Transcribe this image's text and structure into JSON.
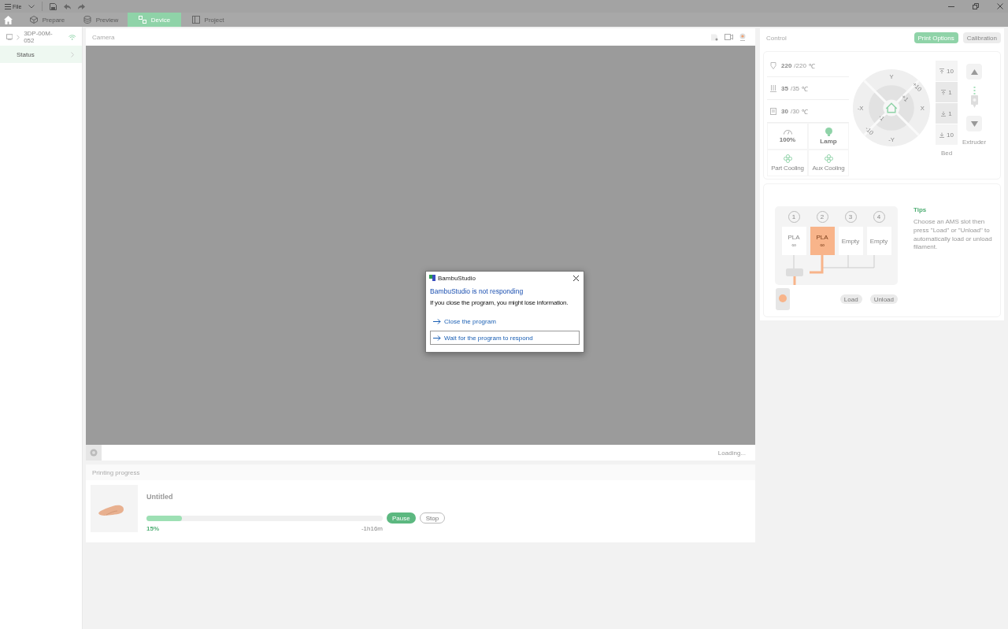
{
  "menu": {
    "file_label": "File"
  },
  "tabs": [
    {
      "label": "Prepare",
      "kind": "prepare",
      "selected": false
    },
    {
      "label": "Preview",
      "kind": "preview",
      "selected": false
    },
    {
      "label": "Device",
      "kind": "device",
      "selected": true
    },
    {
      "label": "Project",
      "kind": "project",
      "selected": false
    }
  ],
  "sidebar": {
    "device_name": "3DP-00M-052",
    "items": [
      {
        "label": "Status",
        "selected": true
      }
    ]
  },
  "camera": {
    "title": "Camera",
    "status": "Loading..."
  },
  "progress": {
    "title": "Printing progress",
    "job_name": "Untitled",
    "level": 0.15,
    "percent": "15%",
    "remaining": "-1h16m",
    "buttons": [
      "Pause",
      "Stop"
    ]
  },
  "control": {
    "title": "Control",
    "buttons": [
      {
        "label": "Print Options",
        "selected": true
      },
      {
        "label": "Calibration",
        "selected": false
      }
    ],
    "temps": [
      {
        "kind": "nozzle",
        "value": "220",
        "target": "/220",
        "unit": "℃"
      },
      {
        "kind": "bed",
        "value": "35",
        "target": "/35",
        "unit": "℃"
      },
      {
        "kind": "chamber",
        "value": "30",
        "target": "/30",
        "unit": "℃"
      }
    ],
    "speed": "100%",
    "lamp": "Lamp",
    "fans": [
      "Part Cooling",
      "Aux Cooling"
    ],
    "jog": {
      "y_plus": "Y",
      "y_minus": "-Y",
      "x_minus": "-X",
      "x_plus": "X",
      "plus_10": "+10",
      "plus_1": "+1",
      "minus_1": "-1",
      "minus_10": "-10"
    },
    "bed_steps": [
      {
        "kind": "up",
        "label": "10"
      },
      {
        "kind": "up",
        "label": "1"
      },
      {
        "kind": "down",
        "label": "1"
      },
      {
        "kind": "down",
        "label": "10"
      }
    ],
    "bed_label": "Bed",
    "extruder_label": "Extruder"
  },
  "ams": {
    "slots": [
      {
        "number": "1",
        "material": "PLA",
        "remain": "∞",
        "selected": false
      },
      {
        "number": "2",
        "material": "PLA",
        "remain": "∞",
        "selected": true
      },
      {
        "number": "3",
        "material": "Empty",
        "selected": false
      },
      {
        "number": "4",
        "material": "Empty",
        "selected": false
      }
    ],
    "tips_title": "Tips",
    "tips_text": "Choose an AMS slot then press \"Load\" or \"Unload\" to automatically load or unload filament.",
    "buttons": [
      "Load",
      "Unload"
    ]
  },
  "dialog": {
    "title": "BambuStudio",
    "heading": "BambuStudio is not responding",
    "message": "If you close the program, you might lose information.",
    "options": [
      {
        "label": "Close the program",
        "selected": false
      },
      {
        "label": "Wait for the program to respond",
        "selected": true
      }
    ]
  }
}
